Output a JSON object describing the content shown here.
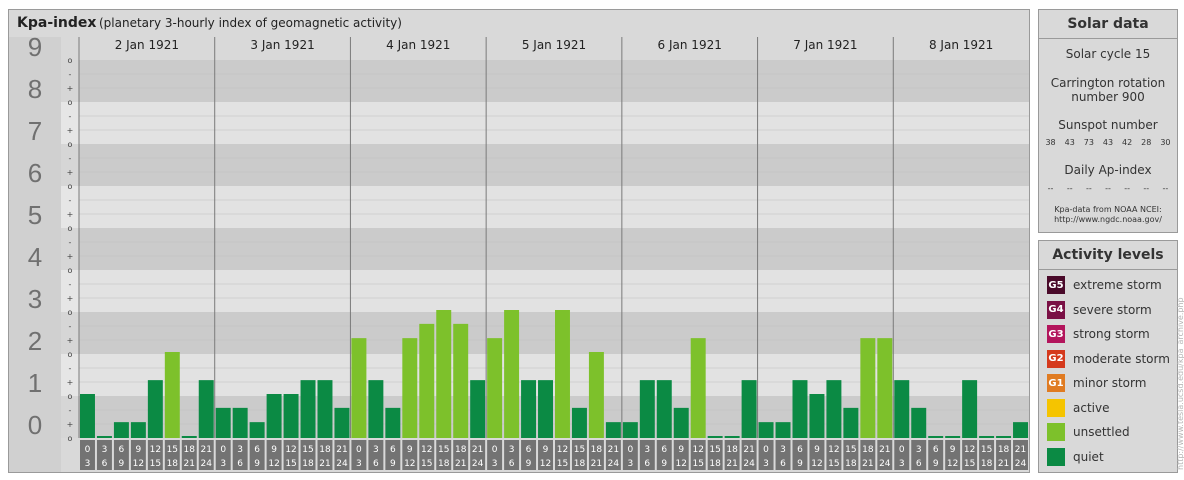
{
  "header": {
    "title": "Kpa-index",
    "subtitle": "(planetary 3-hourly index of geomagnetic activity)"
  },
  "chart_data": {
    "type": "bar",
    "title": "Kpa-index",
    "subtitle": "(planetary 3-hourly index of geomagnetic activity)",
    "ylim": [
      0,
      9
    ],
    "y_ticks": [
      "0",
      "1",
      "2",
      "3",
      "4",
      "5",
      "6",
      "7",
      "8",
      "9"
    ],
    "minor_ticks": [
      "-",
      "o",
      "+"
    ],
    "days": [
      "2 Jan 1921",
      "3 Jan 1921",
      "4 Jan 1921",
      "5 Jan 1921",
      "6 Jan 1921",
      "7 Jan 1921",
      "8 Jan 1921"
    ],
    "interval_starts": [
      "0",
      "3",
      "6",
      "9",
      "12",
      "15",
      "18",
      "21"
    ],
    "interval_ends": [
      "3",
      "6",
      "9",
      "12",
      "15",
      "18",
      "21",
      "24"
    ],
    "values": [
      [
        1.0,
        0.0,
        0.33,
        0.33,
        1.33,
        2.0,
        0.0,
        1.33
      ],
      [
        0.67,
        0.67,
        0.33,
        1.0,
        1.0,
        1.33,
        1.33,
        0.67
      ],
      [
        2.33,
        1.33,
        0.67,
        2.33,
        2.67,
        3.0,
        2.67,
        1.33
      ],
      [
        2.33,
        3.0,
        1.33,
        1.33,
        3.0,
        0.67,
        2.0,
        0.33
      ],
      [
        0.33,
        1.33,
        1.33,
        0.67,
        2.33,
        0.0,
        0.0,
        1.33
      ],
      [
        0.33,
        0.33,
        1.33,
        1.0,
        1.33,
        0.67,
        2.33,
        2.33
      ],
      [
        1.33,
        0.67,
        0.0,
        0.0,
        1.33,
        0.0,
        0.0,
        0.33
      ]
    ],
    "levels": [
      "extreme storm",
      "severe storm",
      "strong storm",
      "moderate storm",
      "minor storm",
      "active",
      "unsettled",
      "quiet"
    ],
    "level_colors": {
      "quiet": "#0b8a44",
      "unsettled": "#7dc12b",
      "active": "#f5c400",
      "minor storm": "#e07b22",
      "moderate storm": "#d5391c",
      "strong storm": "#b3155c",
      "severe storm": "#7a1045",
      "extreme storm": "#4a0a2a"
    }
  },
  "solar": {
    "heading": "Solar data",
    "cycle": "Solar cycle 15",
    "carrington_line1": "Carrington rotation",
    "carrington_line2": "number 900",
    "sunspot_label": "Sunspot number",
    "sunspot_values": [
      "38",
      "43",
      "73",
      "43",
      "42",
      "28",
      "30"
    ],
    "ap_label": "Daily Ap-index",
    "ap_values": [
      "--",
      "--",
      "--",
      "--",
      "--",
      "--",
      "--"
    ],
    "source_line1": "Kpa-data from NOAA NCEI:",
    "source_line2": "http://www.ngdc.noaa.gov/"
  },
  "activity": {
    "heading": "Activity levels",
    "items": [
      {
        "code": "G5",
        "label": "extreme storm",
        "color": "#4a0a2a"
      },
      {
        "code": "G4",
        "label": "severe storm",
        "color": "#7a1045"
      },
      {
        "code": "G3",
        "label": "strong storm",
        "color": "#b3155c"
      },
      {
        "code": "G2",
        "label": "moderate storm",
        "color": "#d5391c"
      },
      {
        "code": "G1",
        "label": "minor storm",
        "color": "#e07b22"
      },
      {
        "code": "",
        "label": "active",
        "color": "#f5c400"
      },
      {
        "code": "",
        "label": "unsettled",
        "color": "#7dc12b"
      },
      {
        "code": "",
        "label": "quiet",
        "color": "#0b8a44"
      }
    ]
  },
  "watermark": "http://www.tesla.ucsd.edu/kpa_archive.php"
}
